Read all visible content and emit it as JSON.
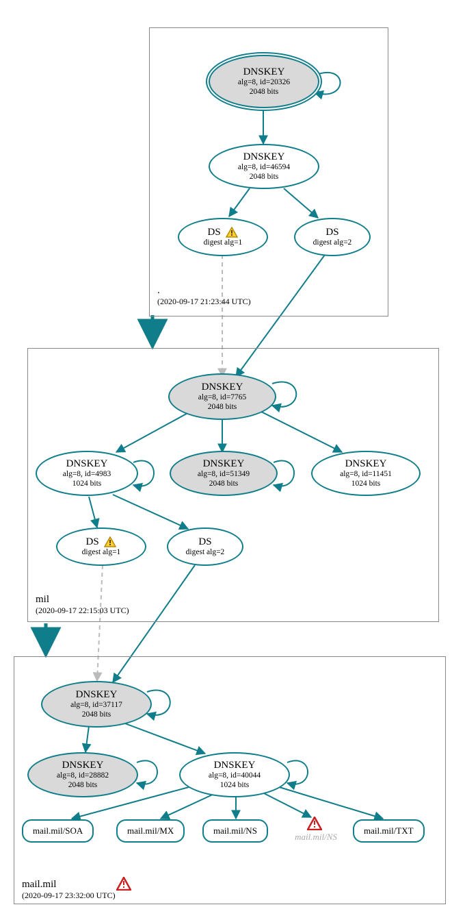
{
  "zones": {
    "root": {
      "name": ".",
      "timestamp": "(2020-09-17 21:23:44 UTC)"
    },
    "mil": {
      "name": "mil",
      "timestamp": "(2020-09-17 22:15:03 UTC)"
    },
    "mailmil": {
      "name": "mail.mil",
      "timestamp": "(2020-09-17 23:32:00 UTC)"
    }
  },
  "nodes": {
    "root_ksk": {
      "title": "DNSKEY",
      "sub1": "alg=8, id=20326",
      "sub2": "2048 bits"
    },
    "root_zsk": {
      "title": "DNSKEY",
      "sub1": "alg=8, id=46594",
      "sub2": "2048 bits"
    },
    "root_ds1": {
      "title": "DS",
      "sub1": "digest alg=1"
    },
    "root_ds2": {
      "title": "DS",
      "sub1": "digest alg=2"
    },
    "mil_ksk": {
      "title": "DNSKEY",
      "sub1": "alg=8, id=7765",
      "sub2": "2048 bits"
    },
    "mil_zsk1": {
      "title": "DNSKEY",
      "sub1": "alg=8, id=4983",
      "sub2": "1024 bits"
    },
    "mil_zsk2": {
      "title": "DNSKEY",
      "sub1": "alg=8, id=51349",
      "sub2": "2048 bits"
    },
    "mil_zsk3": {
      "title": "DNSKEY",
      "sub1": "alg=8, id=11451",
      "sub2": "1024 bits"
    },
    "mil_ds1": {
      "title": "DS",
      "sub1": "digest alg=1"
    },
    "mil_ds2": {
      "title": "DS",
      "sub1": "digest alg=2"
    },
    "mailmil_ksk": {
      "title": "DNSKEY",
      "sub1": "alg=8, id=37117",
      "sub2": "2048 bits"
    },
    "mailmil_zsk1": {
      "title": "DNSKEY",
      "sub1": "alg=8, id=28882",
      "sub2": "2048 bits"
    },
    "mailmil_zsk2": {
      "title": "DNSKEY",
      "sub1": "alg=8, id=40044",
      "sub2": "1024 bits"
    },
    "rec_soa": {
      "label": "mail.mil/SOA"
    },
    "rec_mx": {
      "label": "mail.mil/MX"
    },
    "rec_ns": {
      "label": "mail.mil/NS"
    },
    "rec_txt": {
      "label": "mail.mil/TXT"
    },
    "rec_ns_ghost": {
      "label": "mail.mil/NS"
    }
  }
}
